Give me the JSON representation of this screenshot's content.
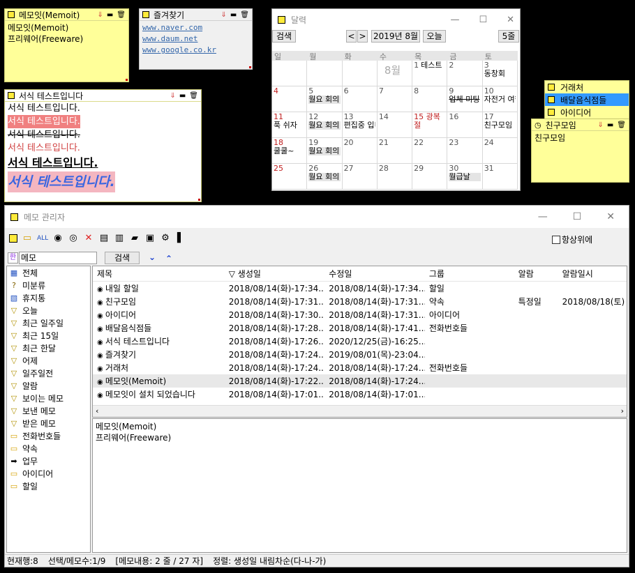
{
  "memo1": {
    "title": "메모잇(Memoit)",
    "lines": [
      "메모잇(Memoit)",
      "프리웨어(Freeware)"
    ]
  },
  "favorites": {
    "title": "즐겨찾기",
    "links": [
      "www.naver.com",
      "www.daum.net",
      "www.google.co.kr"
    ]
  },
  "format_memo": {
    "title": "서식 테스트입니다",
    "lines": [
      "서식 테스트입니다.",
      "서식 테스트입니다.",
      "서식 테스트입니다.",
      "서식 테스트입니다.",
      "서식 테스트입니다.",
      "서식 테스트입니다."
    ]
  },
  "calendar": {
    "title": "달력",
    "search_btn": "검색",
    "prev": "<",
    "next": ">",
    "month_label": "2019년 8월",
    "today_btn": "오늘",
    "view_btn": "5줄",
    "weekdays": [
      "일",
      "월",
      "화",
      "수",
      "목",
      "금",
      "토"
    ],
    "month_watermark": "8월",
    "weeks": [
      [
        {
          "n": ""
        },
        {
          "n": ""
        },
        {
          "n": ""
        },
        {
          "n": ""
        },
        {
          "n": "1",
          "e": "테스트"
        },
        {
          "n": "2"
        },
        {
          "n": "3",
          "e": "동창회"
        }
      ],
      [
        {
          "n": "4",
          "sun": true
        },
        {
          "n": "5",
          "e": "월요 회의",
          "b": true
        },
        {
          "n": "6"
        },
        {
          "n": "7"
        },
        {
          "n": "8"
        },
        {
          "n": "9",
          "e": "업체 미팅"
        },
        {
          "n": "10",
          "e": "자전거 여행"
        }
      ],
      [
        {
          "n": "11",
          "sun": true,
          "e": "푹 쉬자"
        },
        {
          "n": "12",
          "e": "월요 회의",
          "b": true
        },
        {
          "n": "13",
          "e": "편집중 입니다"
        },
        {
          "n": "14"
        },
        {
          "n": "15 광복절",
          "sun": true
        },
        {
          "n": "16"
        },
        {
          "n": "17",
          "e": "친구모임"
        }
      ],
      [
        {
          "n": "18",
          "sun": true,
          "e": "쿨쿨~"
        },
        {
          "n": "19",
          "e": "월요 회의",
          "b": true
        },
        {
          "n": "20"
        },
        {
          "n": "21"
        },
        {
          "n": "22"
        },
        {
          "n": "23"
        },
        {
          "n": "24"
        }
      ],
      [
        {
          "n": "25",
          "sun": true
        },
        {
          "n": "26",
          "e": "월요 회의",
          "b": true
        },
        {
          "n": "27"
        },
        {
          "n": "28"
        },
        {
          "n": "29"
        },
        {
          "n": "30",
          "e": "월급날",
          "b": true
        },
        {
          "n": "31"
        }
      ]
    ]
  },
  "groups": {
    "items": [
      "거래처",
      "배달음식점들",
      "아이디어"
    ],
    "selected": 1
  },
  "friend_memo": {
    "title": "친구모임",
    "body": "친구모임"
  },
  "manager": {
    "title": "메모 관리자",
    "always_on_top": "항상위에",
    "search_value": "메모",
    "ime": "한",
    "search_btn": "검색",
    "tree": [
      {
        "icon": "all",
        "label": "전체"
      },
      {
        "icon": "?",
        "label": "미분류"
      },
      {
        "icon": "trash",
        "label": "휴지통"
      },
      {
        "icon": "filter",
        "label": "오늘"
      },
      {
        "icon": "filter",
        "label": "최근 일주일"
      },
      {
        "icon": "filter",
        "label": "최근 15일"
      },
      {
        "icon": "filter",
        "label": "최근 한달"
      },
      {
        "icon": "filter",
        "label": "어제"
      },
      {
        "icon": "filter",
        "label": "일주일전"
      },
      {
        "icon": "filter",
        "label": "알람"
      },
      {
        "icon": "filter",
        "label": "보이는 메모"
      },
      {
        "icon": "filter",
        "label": "보낸 메모"
      },
      {
        "icon": "filter",
        "label": "받은 메모"
      },
      {
        "icon": "folder",
        "label": "전화번호들"
      },
      {
        "icon": "folder",
        "label": "약속"
      },
      {
        "icon": "arrow",
        "label": "업무"
      },
      {
        "icon": "folder",
        "label": "아이디어"
      },
      {
        "icon": "folder",
        "label": "할일"
      }
    ],
    "columns": [
      "제목",
      "▽ 생성일",
      "수정일",
      "그룹",
      "알람",
      "알람일시"
    ],
    "rows": [
      {
        "title": "내일 할일",
        "created": "2018/08/14(화)-17:34...",
        "modified": "2018/08/14(화)-17:34...",
        "group": "할일",
        "alarm": "",
        "alarm_at": ""
      },
      {
        "title": "친구모임",
        "created": "2018/08/14(화)-17:31...",
        "modified": "2018/08/14(화)-17:31...",
        "group": "약속",
        "alarm": "특정일",
        "alarm_at": "2018/08/18(토)"
      },
      {
        "title": "아이디어",
        "created": "2018/08/14(화)-17:30...",
        "modified": "2018/08/14(화)-17:31...",
        "group": "아이디어",
        "alarm": "",
        "alarm_at": ""
      },
      {
        "title": "배달음식점들",
        "created": "2018/08/14(화)-17:28...",
        "modified": "2018/08/14(화)-17:41...",
        "group": "전화번호들",
        "alarm": "",
        "alarm_at": ""
      },
      {
        "title": "서식 테스트입니다",
        "created": "2018/08/14(화)-17:26...",
        "modified": "2020/12/25(금)-16:25...",
        "group": "",
        "alarm": "",
        "alarm_at": ""
      },
      {
        "title": "즐겨찾기",
        "created": "2018/08/14(화)-17:24...",
        "modified": "2019/08/01(목)-23:04...",
        "group": "",
        "alarm": "",
        "alarm_at": ""
      },
      {
        "title": "거래처",
        "created": "2018/08/14(화)-17:24...",
        "modified": "2018/08/14(화)-17:24...",
        "group": "전화번호들",
        "alarm": "",
        "alarm_at": ""
      },
      {
        "title": "메모잇(Memoit)",
        "created": "2018/08/14(화)-17:22...",
        "modified": "2018/08/14(화)-17:24...",
        "group": "",
        "alarm": "",
        "alarm_at": ""
      },
      {
        "title": "메모잇이 설치 되었습니다",
        "created": "2018/08/14(화)-17:01...",
        "modified": "2018/08/14(화)-17:01...",
        "group": "",
        "alarm": "",
        "alarm_at": ""
      }
    ],
    "selected_row": 7,
    "preview": [
      "메모잇(Memoit)",
      "프리웨어(Freeware)"
    ],
    "status": [
      "현재행:8",
      "선택/메모수:1/9",
      "[메모내용: 2 줄 / 27 자]",
      "정렬: 생성일 내림차순(다-나-가)"
    ]
  },
  "colors": {
    "memo_yellow": "#ffff99",
    "select_blue": "#3399ff",
    "sunday_red": "#c02020",
    "link_blue": "#3366aa"
  }
}
